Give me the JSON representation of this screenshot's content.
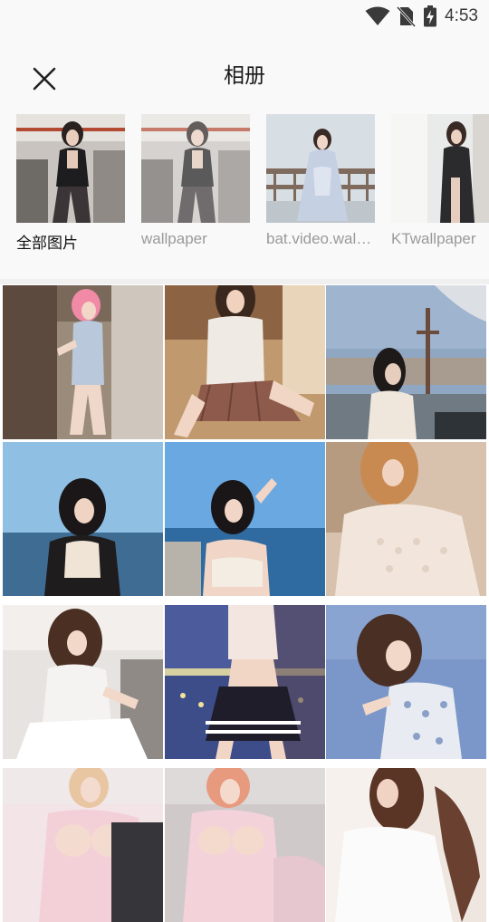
{
  "status_bar": {
    "time": "4:53",
    "icons": [
      "wifi-icon",
      "no-sim-icon",
      "battery-charging-icon"
    ]
  },
  "header": {
    "title": "相册",
    "close_icon": "close-icon"
  },
  "albums": [
    {
      "name": "全部图片",
      "selected": true
    },
    {
      "name": "wallpaper",
      "selected": false
    },
    {
      "name": "bat.video.wal…",
      "selected": false
    },
    {
      "name": "KTwallpaper",
      "selected": false
    }
  ],
  "photos": [
    {
      "subject": "girl-pink-hair-cheongsam"
    },
    {
      "subject": "girl-white-tee-plaid-skirt"
    },
    {
      "subject": "girl-rooftop-cross"
    },
    {
      "subject": "girl-sea-black-cardigan"
    },
    {
      "subject": "girl-sea-white-top"
    },
    {
      "subject": "girl-knit-sweater"
    },
    {
      "subject": "girl-white-lace-dress"
    },
    {
      "subject": "girl-pleated-skirt-night"
    },
    {
      "subject": "girl-floral-dress"
    },
    {
      "subject": "girl-pink-lingerie"
    },
    {
      "subject": "girl-pink-lingerie-sofa"
    },
    {
      "subject": "girl-white-shirt"
    }
  ],
  "colors": {
    "background": "#f9f9f9",
    "text_primary": "#111111",
    "text_secondary": "#9a9a9a"
  }
}
